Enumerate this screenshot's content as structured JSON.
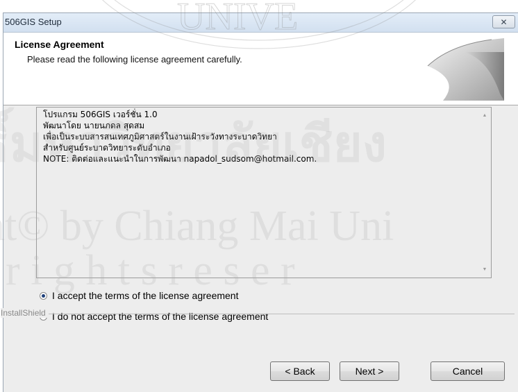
{
  "window": {
    "title": "506GIS Setup",
    "close_icon": "close-icon"
  },
  "header": {
    "title": "License Agreement",
    "subtitle": "Please read the following license agreement carefully."
  },
  "license": {
    "lines": [
      "โปรแกรม 506GIS เวอร์ชั่น 1.0",
      "พัฒนาโดย นายนภดล สุดสม",
      "เพื่อเป็นระบบสารสนเทศภูมิศาสตร์ในงานเฝ้าระวังทางระบาดวิทยา",
      "สำหรับศูนย์ระบาดวิทยาระดับอำเภอ",
      "NOTE: ติดต่อและแนะนำในการพัฒนา napadol_sudsom@hotmail.com."
    ]
  },
  "options": {
    "accept": "I accept the terms of the license agreement",
    "decline": "I do not accept the terms of the license agreement",
    "selected": "accept"
  },
  "footer": {
    "installshield": "InstallShield"
  },
  "buttons": {
    "back": "< Back",
    "next": "Next >",
    "cancel": "Cancel"
  },
  "watermark": {
    "line1": "UNIVE",
    "line2": "ธิ์มหาวิทยาลัยเชียง",
    "line3": "ht© by Chiang Mai Uni",
    "line4": "r i g h t s   r e s e r"
  },
  "colors": {
    "window_bg": "#ededed",
    "header_bg": "#ffffff",
    "radio_dot": "#1d3f7a"
  }
}
